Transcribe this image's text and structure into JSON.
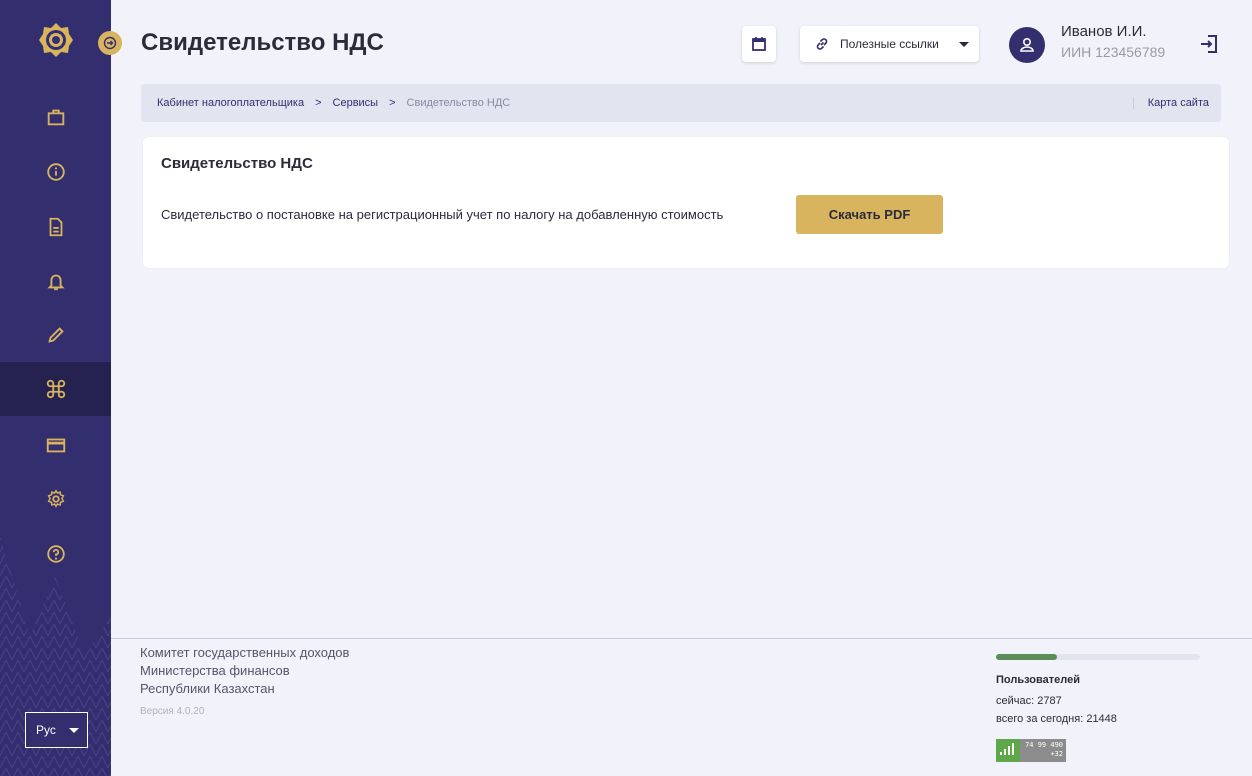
{
  "header": {
    "title": "Свидетельство НДС",
    "links_label": "Полезные ссылки",
    "user_name": "Иванов И.И.",
    "user_iin": "ИИН 123456789"
  },
  "breadcrumb": {
    "items": [
      "Кабинет налогоплательщика",
      "Сервисы"
    ],
    "separator": ">",
    "current": "Свидетельство НДС",
    "sitemap": "Карта сайта"
  },
  "card": {
    "title": "Свидетельство НДС",
    "text": "Свидетельство о постановке на регистрационный учет по налогу на добавленную стоимость",
    "button_label": "Скачать PDF"
  },
  "sidebar": {
    "items": [
      {
        "icon": "briefcase-icon"
      },
      {
        "icon": "info-icon"
      },
      {
        "icon": "document-icon"
      },
      {
        "icon": "bell-icon"
      },
      {
        "icon": "pencil-icon"
      },
      {
        "icon": "command-icon",
        "active": true
      },
      {
        "icon": "card-icon"
      },
      {
        "icon": "gear-icon"
      },
      {
        "icon": "help-icon"
      }
    ],
    "language": "Рус"
  },
  "footer": {
    "org_lines": [
      "Комитет государственных доходов",
      "Министерства финансов",
      "Республики Казахстан"
    ],
    "version": "Версия 4.0.20",
    "users_title": "Пользователей",
    "users_now": "сейчас: 2787",
    "users_today": "всего за сегодня: 21448",
    "users_progress": 0.3,
    "counter_line1": "74 99 490",
    "counter_line2": "+32"
  },
  "colors": {
    "sidebar": "#332e6e",
    "accent": "#d8b45e",
    "background": "#f2f3fa",
    "progress": "#5a8d58"
  }
}
